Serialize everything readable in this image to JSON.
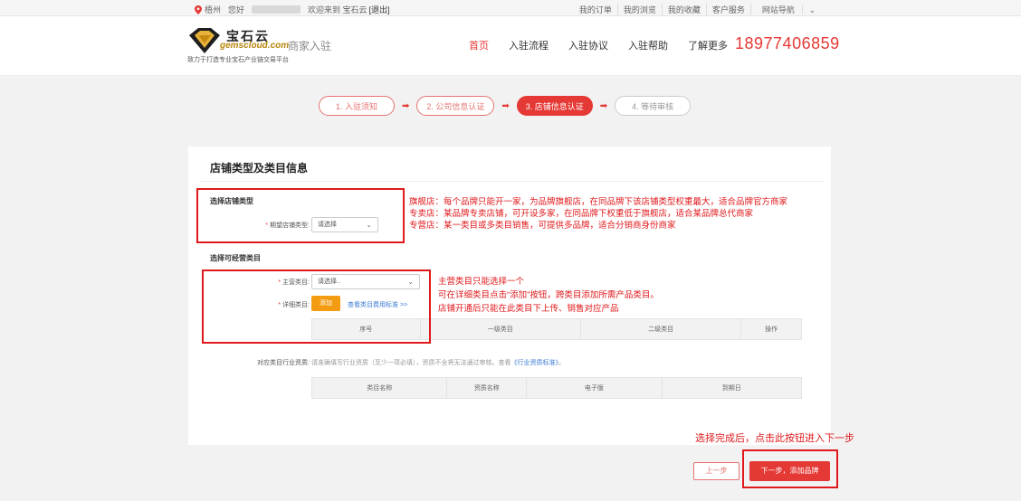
{
  "topbar": {
    "city": "梧州",
    "greeting": "您好",
    "welcome": "欢迎来到 宝石云",
    "logout": "[退出]",
    "links": [
      "我的订单",
      "我的浏览",
      "我的收藏",
      "客户服务",
      "网站导航"
    ]
  },
  "header": {
    "brand": "宝石云",
    "domain": "gemscloud.com",
    "slogan": "致力于打造专业宝石产业链交易平台",
    "merchant_label": "商家入驻",
    "nav": [
      "首页",
      "入驻流程",
      "入驻协议",
      "入驻帮助",
      "了解更多"
    ],
    "phone": "18977406859"
  },
  "steps": [
    "1. 入驻须知",
    "2. 公司信息认证",
    "3. 店铺信息认证",
    "4. 等待审核"
  ],
  "panel": {
    "title": "店铺类型及类目信息",
    "shop_type_section": "选择店铺类型",
    "shop_type_label": "期望店铺类型:",
    "shop_type_value": "请选择",
    "category_section": "选择可经营类目",
    "main_category_label": "主营类目:",
    "main_category_value": "请选择..",
    "detail_category_label": "详细类目:",
    "add_button": "添加",
    "fee_link": "查看类目费用标准 >>",
    "category_table_headers": [
      "序号",
      "一级类目",
      "二级类目",
      "操作"
    ],
    "qualification_label": "对应类目行业资质:",
    "qualification_hint": "请准确填写行业资质（至少一项必填），资质不全将无法通过审核。查看",
    "qualification_link": "《行业资质标准》",
    "qualification_hint_end": "。",
    "qualification_table_headers": [
      "类目名称",
      "资质名称",
      "电子版",
      "到期日"
    ]
  },
  "annotations": {
    "shop_types": [
      "旗舰店：每个品牌只能开一家，为品牌旗舰店，在同品牌下该店铺类型权重最大，适合品牌官方商家",
      "专卖店：某品牌专卖店铺，可开设多家，在同品牌下权重低于旗舰店，适合某品牌总代商家",
      "专营店：某一类目或多类目销售，可提供多品牌，适合分销商身份商家"
    ],
    "categories": [
      "主营类目只能选择一个",
      "可在详细类目点击“添加”按钮，跨类目添加所需产品类目。",
      "店铺开通后只能在此类目下上传、销售对应产品"
    ],
    "next_hint": "选择完成后，点击此按钮进入下一步"
  },
  "buttons": {
    "prev": "上一步",
    "next": "下一步，添加品牌"
  },
  "colors": {
    "accent": "#e53935",
    "annotation": "#e0191c",
    "orange": "#f39c12",
    "link": "#3a7bd5"
  }
}
